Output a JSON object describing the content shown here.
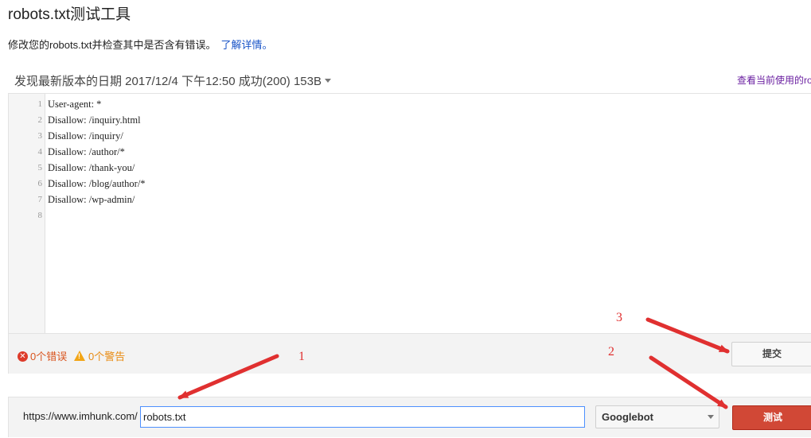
{
  "page": {
    "title": "robots.txt测试工具",
    "description": "修改您的robots.txt并检查其中是否含有错误。",
    "learn_more": "了解详情。"
  },
  "version": {
    "label": "发现最新版本的日期 2017/12/4 下午12:50 成功(200) 153B",
    "view_live": "查看当前使用的robots.txt"
  },
  "editor": {
    "line_numbers": [
      "1",
      "2",
      "3",
      "4",
      "5",
      "6",
      "7",
      "8"
    ],
    "lines": [
      "User-agent: *",
      "Disallow: /inquiry.html",
      "Disallow: /inquiry/",
      "Disallow: /author/*",
      "Disallow: /thank-you/",
      "Disallow: /blog/author/*",
      "Disallow: /wp-admin/",
      ""
    ]
  },
  "status": {
    "errors": "0个错误",
    "warnings": "0个警告",
    "error_icon": "x-circle-icon",
    "warning_icon": "warning-triangle-icon"
  },
  "actions": {
    "submit": "提交",
    "test": "测试"
  },
  "test_bar": {
    "url_prefix": "https://www.imhunk.com/",
    "url_value": "robots.txt",
    "user_agent": "Googlebot"
  },
  "annotations": {
    "one": "1",
    "two": "2",
    "three": "3"
  },
  "colors": {
    "accent_red": "#d14836",
    "link_blue": "#1a55c8",
    "annotation_red": "#e03030"
  }
}
